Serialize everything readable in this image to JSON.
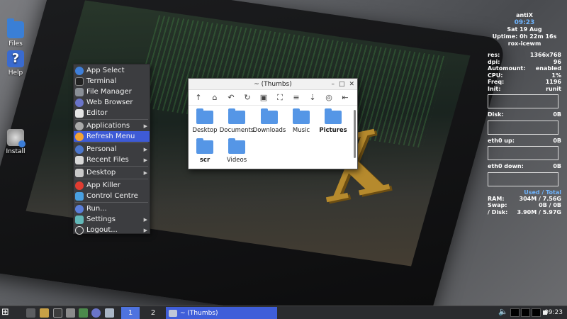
{
  "desktop": {
    "icons": [
      {
        "label": "Files",
        "icon": "folder-icon"
      },
      {
        "label": "Help",
        "icon": "help-icon"
      },
      {
        "label": "Install",
        "icon": "install-disc-icon"
      }
    ]
  },
  "menu": {
    "items": [
      {
        "label": "App Select",
        "icon": "app-select-icon",
        "submenu": false
      },
      {
        "label": "Terminal",
        "icon": "terminal-icon",
        "submenu": false
      },
      {
        "label": "File Manager",
        "icon": "file-manager-icon",
        "submenu": false
      },
      {
        "label": "Web Browser",
        "icon": "globe-icon",
        "submenu": false
      },
      {
        "label": "Editor",
        "icon": "editor-icon",
        "submenu": false
      },
      {
        "label": "Applications",
        "icon": "applications-icon",
        "submenu": true
      },
      {
        "label": "Refresh Menu",
        "icon": "refresh-icon",
        "submenu": false,
        "selected": true
      },
      {
        "label": "Personal",
        "icon": "personal-icon",
        "submenu": true
      },
      {
        "label": "Recent Files",
        "icon": "recent-files-icon",
        "submenu": true
      },
      {
        "label": "Desktop",
        "icon": "desktop-icon",
        "submenu": true
      },
      {
        "label": "App Killer",
        "icon": "app-killer-icon",
        "submenu": false
      },
      {
        "label": "Control Centre",
        "icon": "control-centre-icon",
        "submenu": false
      },
      {
        "label": "Run...",
        "icon": "run-icon",
        "submenu": false
      },
      {
        "label": "Settings",
        "icon": "settings-icon",
        "submenu": true
      },
      {
        "label": "Logout...",
        "icon": "logout-icon",
        "submenu": true
      }
    ]
  },
  "window": {
    "title": "~ (Thumbs)",
    "controls": [
      "–",
      "□",
      "✕"
    ],
    "toolbar": [
      "↑",
      "⌂",
      "↶",
      "↻",
      "▣",
      "⛶",
      "≡",
      "⇣",
      "◎",
      "⇤"
    ],
    "folders": [
      {
        "label": "Desktop",
        "bold": false
      },
      {
        "label": "Documents",
        "bold": false
      },
      {
        "label": "Downloads",
        "bold": false
      },
      {
        "label": "Music",
        "bold": false
      },
      {
        "label": "Pictures",
        "bold": true
      },
      {
        "label": "scr",
        "bold": true
      },
      {
        "label": "Videos",
        "bold": false
      }
    ]
  },
  "conky": {
    "hostname": "antiX",
    "time": "09:23",
    "date": "Sat 19 Aug",
    "uptime": "Uptime: 0h 22m 16s",
    "wm": "rox-icewm",
    "stats": [
      {
        "key": "res:",
        "value": "1366x768"
      },
      {
        "key": "dpi:",
        "value": "96"
      },
      {
        "key": "Automount:",
        "value": "enabled"
      },
      {
        "key": "CPU:",
        "value": "1%"
      },
      {
        "key": "Freq:",
        "value": "1196"
      },
      {
        "key": "Init:",
        "value": "runit"
      }
    ],
    "disk": {
      "label": "Disk:",
      "value": "0B"
    },
    "eth_up": {
      "label": "eth0 up:",
      "value": "0B"
    },
    "eth_down": {
      "label": "eth0 down:",
      "value": "0B"
    },
    "mem_header": "Used / Total",
    "mem": [
      {
        "key": "RAM:",
        "value": "304M / 7.56G"
      },
      {
        "key": "Swap:",
        "value": "0B / 0B"
      },
      {
        "key": "/ Disk:",
        "value": "3.90M / 5.97G"
      }
    ]
  },
  "taskbar": {
    "workspaces": [
      "1",
      "2"
    ],
    "active_workspace": "1",
    "task_label": "~ (Thumbs)",
    "clock": "09:23"
  }
}
